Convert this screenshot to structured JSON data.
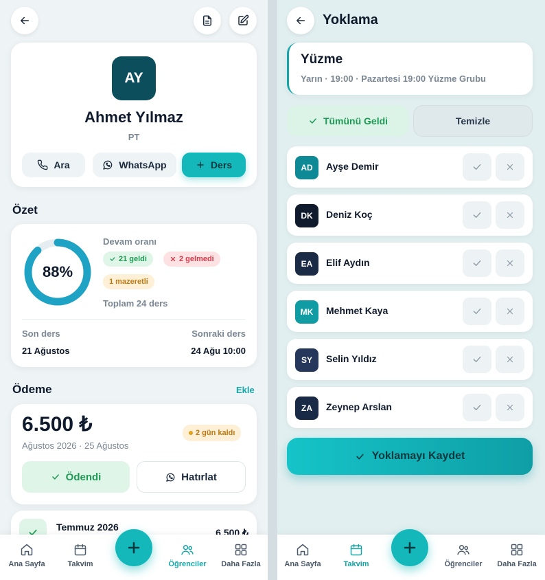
{
  "left": {
    "header": {
      "back_icon": "arrow-left-icon",
      "doc_icon": "document-icon",
      "edit_icon": "edit-icon"
    },
    "profile": {
      "initials": "AY",
      "name": "Ahmet Yılmaz",
      "tag": "PT",
      "actions": {
        "call": "Ara",
        "whatsapp": "WhatsApp",
        "lesson": "Ders"
      }
    },
    "summary": {
      "title": "Özet",
      "percent": "88%",
      "percent_value": 0.88,
      "attendance_label": "Devam oranı",
      "present": "21 geldi",
      "absent": "2 gelmedi",
      "excused": "1 mazeretli",
      "total": "Toplam 24 ders",
      "last_label": "Son ders",
      "last_value": "21 Ağustos",
      "next_label": "Sonraki ders",
      "next_value": "24 Ağu 10:00"
    },
    "payment": {
      "title": "Ödeme",
      "add_link": "Ekle",
      "amount": "6.500 ₺",
      "period": "Ağustos 2026 · 25 Ağustos",
      "due_badge": "2 gün kaldı",
      "paid_button": "Ödendi",
      "remind_button": "Hatırlat",
      "history": [
        {
          "month": "Temmuz 2026",
          "amount": "6.500 ₺"
        }
      ]
    },
    "nav": [
      {
        "label": "Ana Sayfa",
        "icon": "home-icon"
      },
      {
        "label": "Takvim",
        "icon": "calendar-icon"
      },
      {
        "label": "Öğrenciler",
        "icon": "users-icon"
      },
      {
        "label": "Daha Fazla",
        "icon": "grid-icon"
      }
    ],
    "active_nav": "Öğrenciler"
  },
  "right": {
    "title": "Yoklama",
    "session": {
      "name": "Yüzme",
      "details": "Yarın · 19:00 · Pazartesi 19:00 Yüzme Grubu"
    },
    "all_present": "Tümünü Geldi",
    "clear": "Temizle",
    "students": [
      {
        "initials": "AD",
        "name": "Ayşe Demir",
        "color": "#0e8a96"
      },
      {
        "initials": "DK",
        "name": "Deniz Koç",
        "color": "#0f1b2d"
      },
      {
        "initials": "EA",
        "name": "Elif Aydın",
        "color": "#1c2b45"
      },
      {
        "initials": "MK",
        "name": "Mehmet Kaya",
        "color": "#119ba3"
      },
      {
        "initials": "SY",
        "name": "Selin Yıldız",
        "color": "#25385c"
      },
      {
        "initials": "ZA",
        "name": "Zeynep Arslan",
        "color": "#192a46"
      }
    ],
    "save": "Yoklamayı Kaydet",
    "nav": [
      {
        "label": "Ana Sayfa",
        "icon": "home-icon"
      },
      {
        "label": "Takvim",
        "icon": "calendar-icon"
      },
      {
        "label": "Öğrenciler",
        "icon": "users-icon"
      },
      {
        "label": "Daha Fazla",
        "icon": "grid-icon"
      }
    ],
    "active_nav": "Takvim"
  }
}
